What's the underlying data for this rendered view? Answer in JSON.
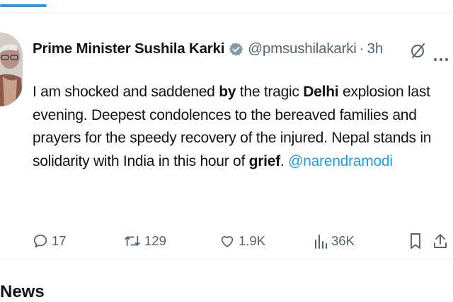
{
  "tweet": {
    "author": {
      "name": "Prime Minister Sushila Karki",
      "handle": "@pmsushilakarki",
      "separator": "·",
      "time": "3h"
    },
    "text": {
      "p1": "I am shocked and saddened ",
      "b1": "by",
      "p2": " the tragic ",
      "b2": "Delhi",
      "p3": " explosion last evening. Deepest condolences to the bereaved families and prayers for the speedy recovery of the injured. Nepal stands in solidarity with India in this hour of ",
      "b3": "grief",
      "p4": ". ",
      "mention": "@narendramodi"
    },
    "actions": {
      "replies": "17",
      "reposts": "129",
      "likes": "1.9K",
      "views": "36K"
    }
  },
  "below_section": {
    "heading": "News"
  },
  "colors": {
    "accent": "#1d9bf0",
    "secondary_text": "#536471",
    "primary_text": "#0f1419"
  },
  "icons": [
    "verified-badge-icon",
    "grok-icon",
    "more-icon",
    "reply-icon",
    "repost-icon",
    "like-icon",
    "views-icon",
    "bookmark-icon",
    "share-icon"
  ]
}
